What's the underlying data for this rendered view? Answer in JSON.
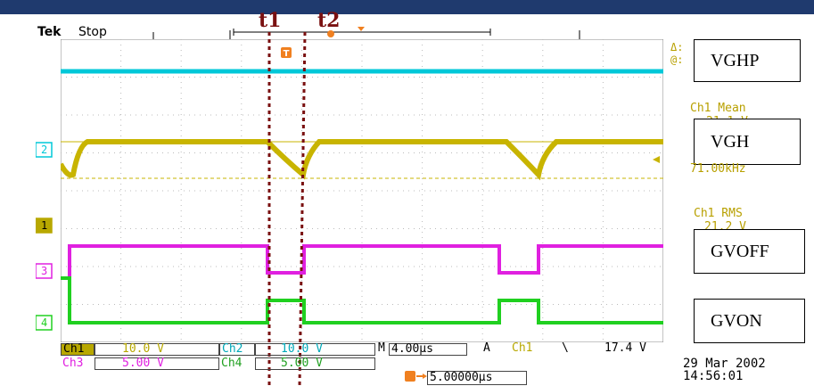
{
  "header": {
    "brand": "Tek",
    "state": "Stop",
    "cursor1": "t1",
    "cursor2": "t2"
  },
  "channels": {
    "ch1": {
      "marker": "1",
      "name": "Ch1",
      "scale": "10.0 V",
      "color": "#b8a800"
    },
    "ch2": {
      "marker": "2",
      "name": "Ch2",
      "scale": "10.0 V",
      "color": "#00c8d8"
    },
    "ch3": {
      "marker": "3",
      "name": "Ch3",
      "scale": "5.00 V",
      "color": "#e020e0"
    },
    "ch4": {
      "marker": "4",
      "name": "Ch4",
      "scale": "5.00 V",
      "color": "#20d020"
    }
  },
  "signals": {
    "vghp": "VGHP",
    "vgh": "VGH",
    "gvoff": "GVOFF",
    "gvon": "GVON"
  },
  "measurements": {
    "delta": "Δ:",
    "at": "@:",
    "mean_label": "Ch1 Mean",
    "mean_value": "21.1 V",
    "freq_value": "71.00kHz",
    "rms_label": "Ch1 RMS",
    "rms_value": "21.2 V"
  },
  "timebase": {
    "m_label": "M",
    "m_value": "4.00μs",
    "trig_mode": "A",
    "trig_source": "Ch1",
    "trig_slope": "\\",
    "trig_level": "17.4 V",
    "trig_pos_value": "5.00000μs"
  },
  "trigger_marker": "T",
  "datetime": {
    "date": "29 Mar 2002",
    "time": "14:56:01"
  },
  "colors": {
    "cyan": "#00c8d8",
    "yellow": "#c8b400",
    "magenta": "#e020e0",
    "green": "#20d020",
    "cursor": "#7a1010",
    "trigger": "#f08020"
  }
}
